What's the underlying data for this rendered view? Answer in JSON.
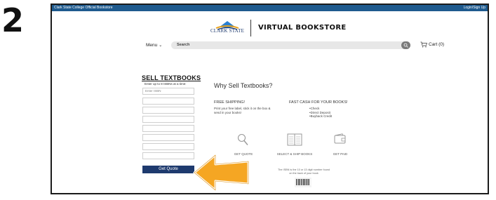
{
  "step_number": "2",
  "topbar": {
    "left_text": "Clark State College Official Bookstore",
    "right_text": "Login/Sign Up"
  },
  "header": {
    "logo_text": "CLARK STATE",
    "store_title": "VIRTUAL BOOKSTORE"
  },
  "nav": {
    "menu_label": "Menu",
    "search_placeholder": "Search",
    "cart_label": "Cart (0)"
  },
  "sell_form": {
    "title": "SELL TEXTBOOKS",
    "subtitle": "Enter up to 8 ISBNs at a time:",
    "first_placeholder": "Enter ISBN",
    "button_label": "Get Quote"
  },
  "info": {
    "title": "Why Sell Textbooks?",
    "free_shipping_heading": "FREE SHIPPING!",
    "free_shipping_text": "Print your free label, stick it on the box & send in your books!",
    "fast_cash_heading": "FAST CASH FOR YOUR BOOKS!",
    "fast_cash_items": [
      "Check",
      "Direct Deposit",
      "Buyback Credit"
    ]
  },
  "steps": [
    {
      "label": "GET QUOTE",
      "icon": "magnifier-icon"
    },
    {
      "label": "SELECT & SHIP BOOKS",
      "icon": "open-book-icon"
    },
    {
      "label": "GET PAID",
      "icon": "wallet-icon"
    }
  ],
  "isbn_note": "The ISBN is the 10 or 13 digit number found on the back of your book",
  "colors": {
    "topbar": "#1e5a8e",
    "button": "#1e3a6e",
    "arrow": "#f5a623",
    "arrow_outline": "#ffffff"
  }
}
